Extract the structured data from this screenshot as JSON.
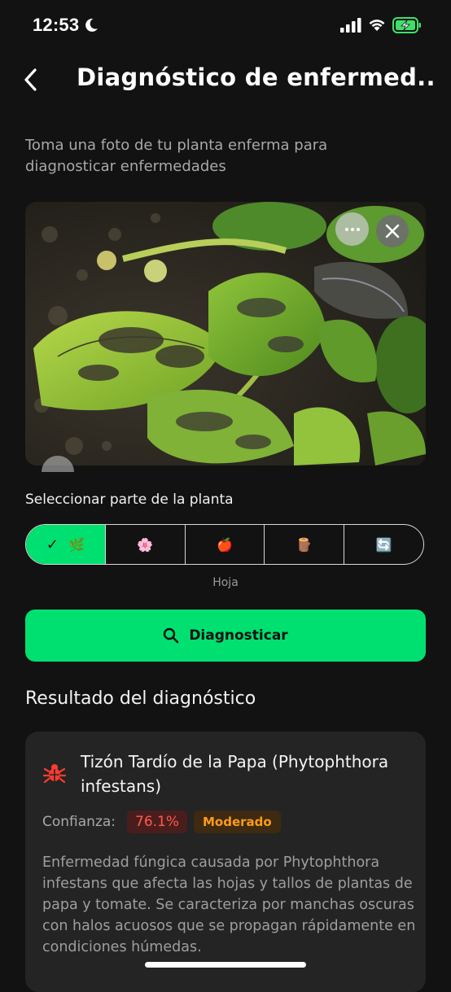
{
  "status_bar": {
    "time": "12:53"
  },
  "header": {
    "title": "Diagnóstico de enfermed..."
  },
  "subtitle": "Toma una foto de tu planta enferma para diagnosticar enfermedades",
  "plant_part": {
    "label": "Seleccionar parte de la planta",
    "options": [
      {
        "icon": "🌿",
        "check": "✓",
        "selected": true
      },
      {
        "icon": "🌸",
        "selected": false
      },
      {
        "icon": "🍎",
        "selected": false
      },
      {
        "icon": "🪵",
        "selected": false
      },
      {
        "icon": "🔄",
        "selected": false
      }
    ],
    "selected_caption": "Hoja"
  },
  "diagnose_button": {
    "label": "Diagnosticar"
  },
  "results": {
    "heading": "Resultado del diagnóstico",
    "disease_name": "Tizón Tardío de la Papa (Phytophthora infestans)",
    "confidence_label": "Confianza:",
    "confidence_value": "76.1%",
    "severity": "Moderado",
    "description": "Enfermedad fúngica causada por Phytophthora infestans que afecta las hojas y tallos de plantas de papa y tomate. Se caracteriza por manchas oscuras con halos acuosos que se propagan rápidamente en condiciones húmedas."
  },
  "colors": {
    "accent": "#00e070",
    "background": "#121212",
    "card": "#242424",
    "danger": "#ff5a4d",
    "warning": "#ff9b1a"
  }
}
